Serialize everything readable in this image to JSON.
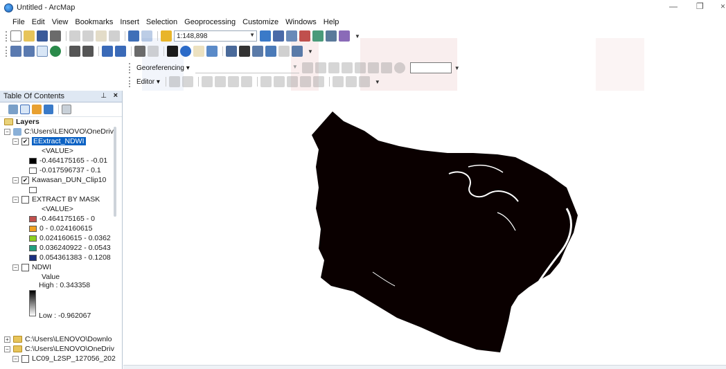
{
  "window": {
    "title": "Untitled - ArcMap",
    "minimize": "—",
    "maximize": "❐",
    "close": "×"
  },
  "menu": [
    "File",
    "Edit",
    "View",
    "Bookmarks",
    "Insert",
    "Selection",
    "Geoprocessing",
    "Customize",
    "Windows",
    "Help"
  ],
  "toolbar": {
    "scale_value": "1:148,898",
    "georeferencing_label": "Georeferencing ▾",
    "editor_label": "Editor ▾"
  },
  "toc": {
    "title": "Table Of Contents",
    "pin": "⊥",
    "close": "×",
    "layers_label": "Layers",
    "items": [
      {
        "label": "C:\\Users\\LENOVO\\OneDriv"
      },
      {
        "label": "EExtract_NDWI",
        "checked": true,
        "selected": true
      },
      {
        "label": "<VALUE>"
      },
      {
        "label": "-0.464175165 - -0.01",
        "color": "#000000"
      },
      {
        "label": "-0.017596737 - 0.1",
        "color": "#ffffff"
      },
      {
        "label": "Kawasan_DUN_Clip10",
        "checked": true
      },
      {
        "label": "EXTRACT BY MASK",
        "checked": false
      },
      {
        "label": "<VALUE>"
      },
      {
        "label": "-0.464175165 - 0",
        "color": "#c0504d"
      },
      {
        "label": "0 - 0.024160615",
        "color": "#f0a020"
      },
      {
        "label": "0.024160615 - 0.0362",
        "color": "#8cd020"
      },
      {
        "label": "0.036240922 - 0.0543",
        "color": "#20a080"
      },
      {
        "label": "0.054361383 - 0.1208",
        "color": "#1a2f80"
      },
      {
        "label": "NDWI",
        "checked": false
      },
      {
        "label": "Value"
      },
      {
        "label": "High : 0.343358"
      },
      {
        "label": "Low : -0.962067"
      },
      {
        "label": "C:\\Users\\LENOVO\\Downlo"
      },
      {
        "label": "C:\\Users\\LENOVO\\OneDriv"
      },
      {
        "label": "LC09_L2SP_127056_202",
        "checked": false
      }
    ]
  },
  "colors": {
    "selection": "#0b62c4",
    "toc_header": "#dfe8f3",
    "raster_dark": "#0a0000"
  }
}
